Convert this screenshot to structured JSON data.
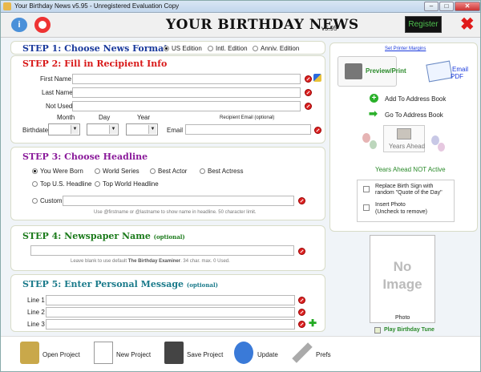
{
  "window": {
    "title": "Your Birthday News v5.95 - Unregistered Evaluation Copy"
  },
  "header": {
    "app_title": "YOUR BIRTHDAY NEWS",
    "version": "v5.95",
    "register_label": "Register"
  },
  "step1": {
    "title": "STEP 1: Choose News Format",
    "formats": [
      "US Edition",
      "Intl. Edition",
      "Anniv. Edition"
    ],
    "selected": "US Edition"
  },
  "step2": {
    "title": "STEP 2: Fill in Recipient Info",
    "first_name_label": "First Name",
    "last_name_label": "Last Name",
    "not_used_label": "Not Used",
    "month_label": "Month",
    "day_label": "Day",
    "year_label": "Year",
    "birthdate_label": "Birthdate",
    "email_label": "Email",
    "recipient_email_label": "Recipient Email (optional)"
  },
  "step3": {
    "title": "STEP 3: Choose Headline",
    "options": [
      "You Were Born",
      "World Series",
      "Best Actor",
      "Best Actress",
      "Top U.S. Headline",
      "Top World Headline",
      "Custom"
    ],
    "selected": "You Were Born",
    "hint": "Use @firstname or @lastname to show name in headline. 50 character limit."
  },
  "step4": {
    "title": "STEP 4: Newspaper Name",
    "optional": "(optional)",
    "hint_prefix": "Leave blank to use default",
    "default_name": "The Birthday Examiner",
    "hint_suffix": ". 34 char. max. 0 Used."
  },
  "step5": {
    "title": "STEP 5: Enter Personal Message",
    "optional": "(optional)",
    "lines": [
      "Line 1",
      "Line 2",
      "Line 3"
    ]
  },
  "side": {
    "printer_margins": "Set Printer Margins",
    "preview_print": "Preview/Print",
    "email_pdf_1": "Email",
    "email_pdf_2": "PDF",
    "add_address_book": "Add To Address Book",
    "go_address_book": "Go To Address Book",
    "years_ahead": "Years Ahead",
    "years_ahead_status": "Years Ahead NOT Active",
    "replace_sign_1": "Replace Birth Sign with",
    "replace_sign_2": "random \"Quote of the Day\"",
    "insert_photo_1": "Insert Photo",
    "insert_photo_2": "(Uncheck to remove)",
    "no_image_1": "No",
    "no_image_2": "Image",
    "photo_label": "Photo",
    "play_tune": "Play Birthday Tune"
  },
  "footer": {
    "open": "Open Project",
    "new": "New Project",
    "save": "Save Project",
    "update": "Update",
    "prefs": "Prefs"
  },
  "colors": {
    "step1": "#1a3a9c",
    "step2": "#d81818",
    "step3": "#8a1a9a",
    "step4": "#1a7a1a",
    "step5": "#1a7a8a",
    "green_text": "#2a8a2a",
    "link": "#1a3adc"
  }
}
